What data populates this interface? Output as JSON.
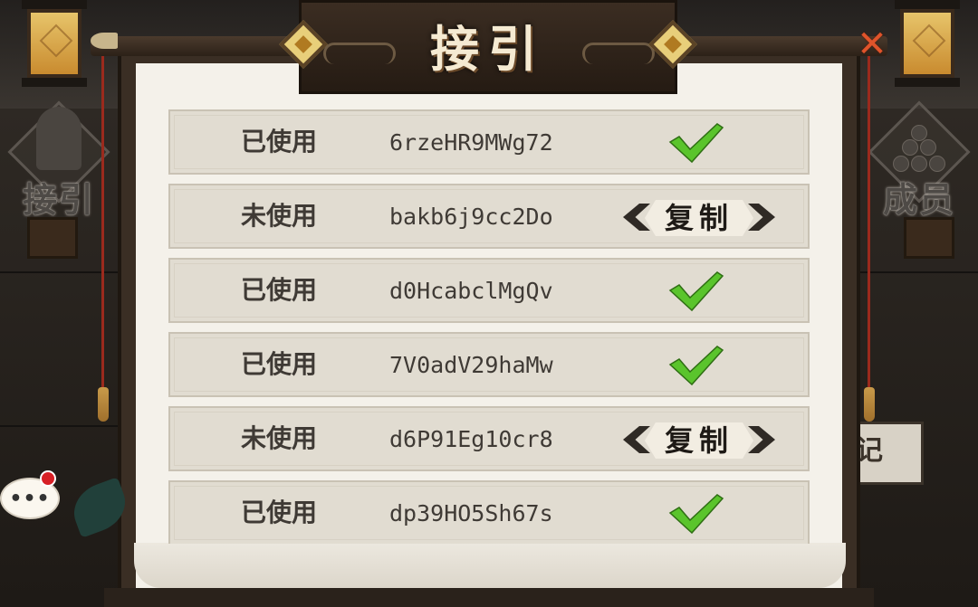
{
  "title": "接引",
  "side_left": {
    "label": "接引"
  },
  "side_right": {
    "label": "成员"
  },
  "side_button": {
    "label": "记"
  },
  "chat": {
    "label": "•••"
  },
  "close": {
    "label": "✕"
  },
  "copy_label": "复制",
  "rows": [
    {
      "status": "",
      "code": "",
      "used": true,
      "partial": true
    },
    {
      "status": "已使用",
      "code": "6rzeHR9MWg72",
      "used": true
    },
    {
      "status": "未使用",
      "code": "bakb6j9cc2Do",
      "used": false
    },
    {
      "status": "已使用",
      "code": "d0HcabclMgQv",
      "used": true
    },
    {
      "status": "已使用",
      "code": "7V0adV29haMw",
      "used": true
    },
    {
      "status": "未使用",
      "code": "d6P91Eg10cr8",
      "used": false
    },
    {
      "status": "已使用",
      "code": "dp39HO5Sh67s",
      "used": true
    }
  ],
  "colors": {
    "check": "#5ac42c",
    "accent_close": "#e0542b",
    "notification": "#d71f25"
  }
}
